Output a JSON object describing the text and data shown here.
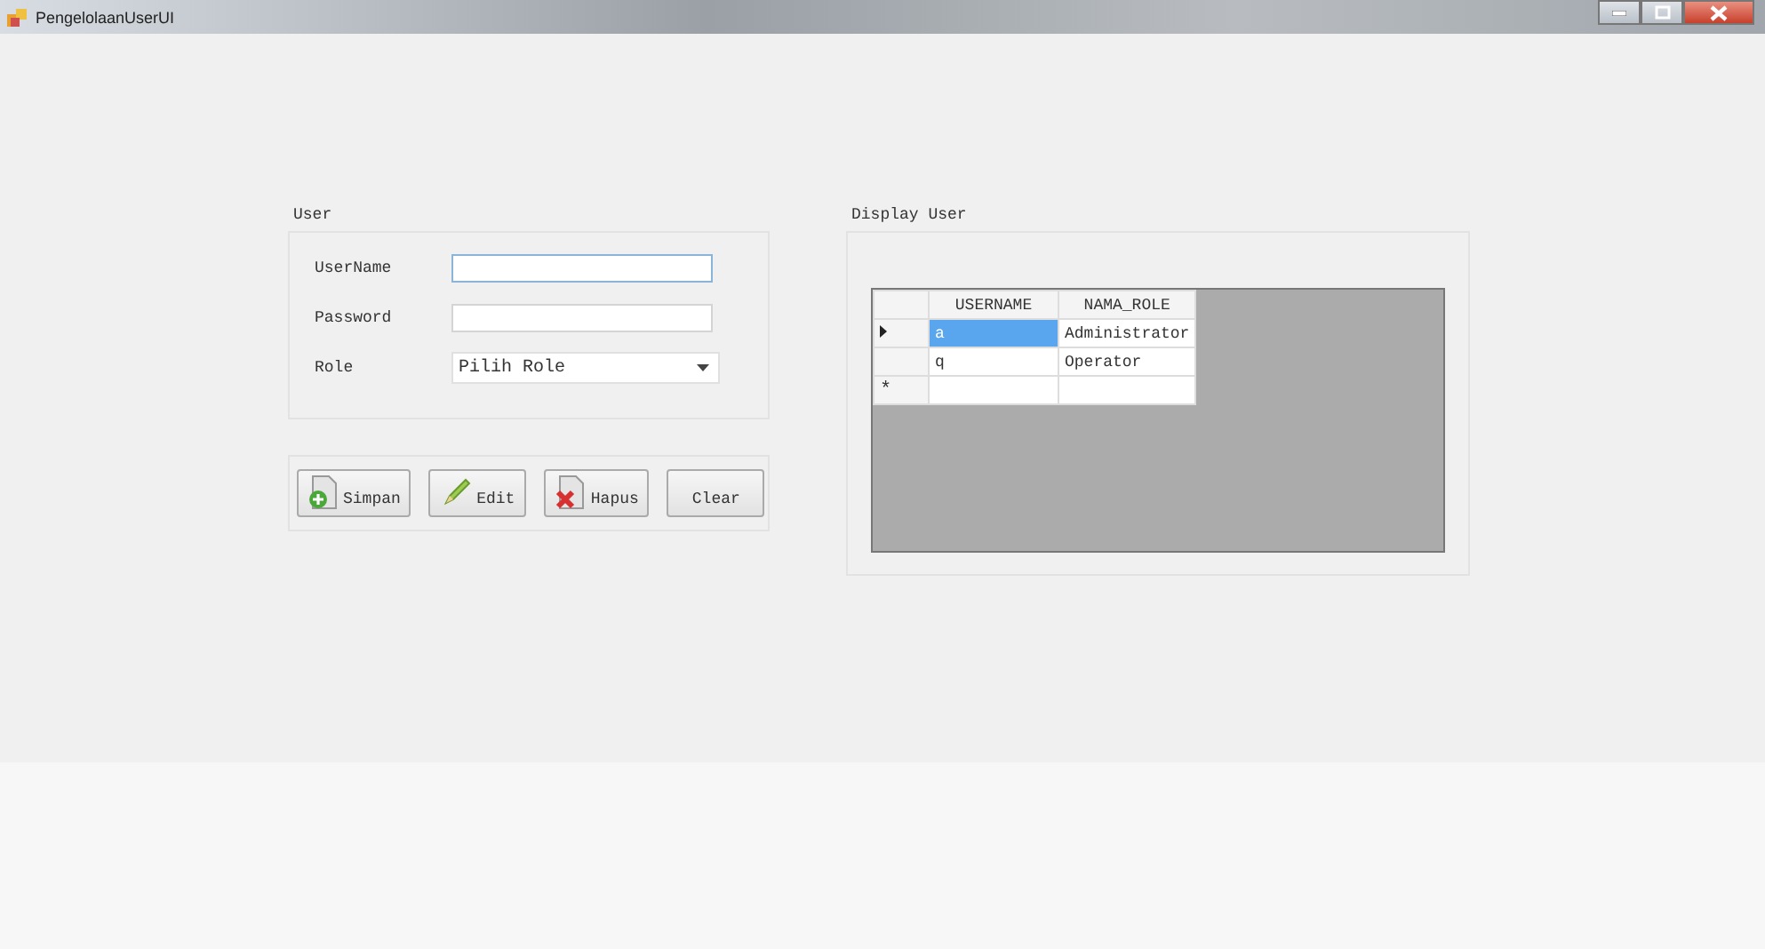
{
  "window": {
    "title": "PengelolaanUserUI"
  },
  "user_group": {
    "title": "User",
    "fields": [
      {
        "kind": "text",
        "label": "UserName"
      },
      {
        "kind": "text",
        "label": "Password"
      },
      {
        "kind": "select",
        "label": "Role",
        "value": "Pilih Role"
      }
    ]
  },
  "buttons": [
    {
      "kind": "save",
      "label": "Simpan"
    },
    {
      "kind": "edit",
      "label": "Edit"
    },
    {
      "kind": "delete",
      "label": "Hapus"
    },
    {
      "kind": "plain",
      "label": "Clear"
    }
  ],
  "display_group": {
    "title": "Display User",
    "table": {
      "columns": [
        "USERNAME",
        "NAMA_ROLE"
      ],
      "rows": [
        {
          "cells": [
            "a",
            "Administrator"
          ],
          "selected": true
        },
        {
          "cells": [
            "q",
            "Operator"
          ],
          "selected": false
        }
      ],
      "new_row_marker": "*"
    }
  }
}
